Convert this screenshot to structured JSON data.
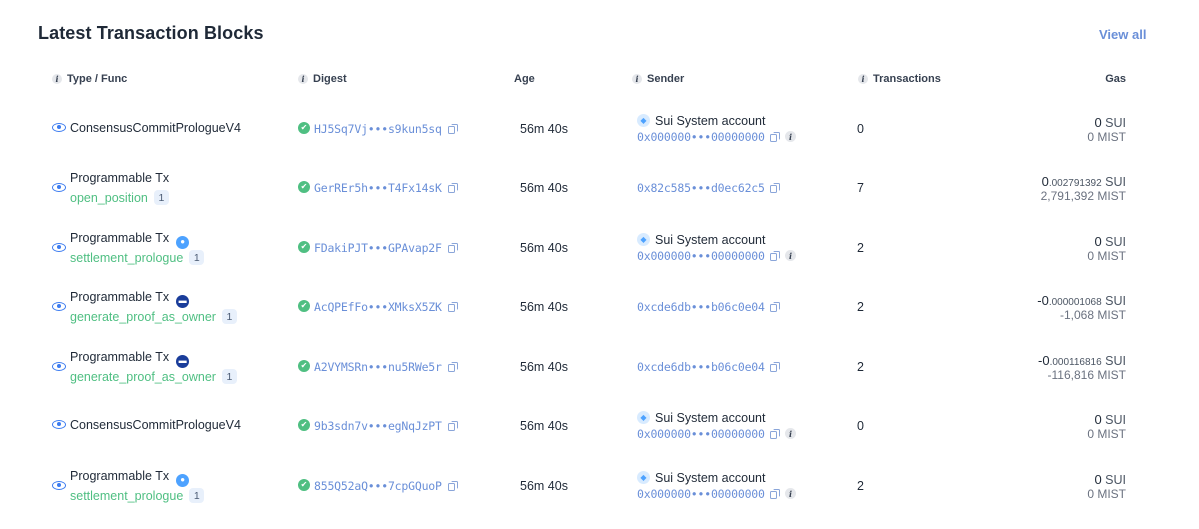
{
  "header": {
    "title": "Latest Transaction Blocks",
    "view_all": "View all"
  },
  "columns": {
    "type": "Type / Func",
    "digest": "Digest",
    "age": "Age",
    "sender": "Sender",
    "transactions": "Transactions",
    "gas": "Gas"
  },
  "rows": [
    {
      "type": "ConsensusCommitPrologueV4",
      "func": "",
      "func_count": "",
      "package_icon": "",
      "digest": "HJ5Sq7Vj•••s9kun5sq",
      "age": "56m 40s",
      "sender_name": "Sui System account",
      "sender_addr": "0x000000•••00000000",
      "tx_count": "0",
      "gas_int": "0",
      "gas_frac": "",
      "gas_unit": "SUI",
      "gas_mist": "0 MIST"
    },
    {
      "type": "Programmable Tx",
      "func": "open_position",
      "func_count": "1",
      "package_icon": "",
      "digest": "GerREr5h•••T4Fx14sK",
      "age": "56m 40s",
      "sender_name": "",
      "sender_addr": "0x82c585•••d0ec62c5",
      "tx_count": "7",
      "gas_int": "0",
      "gas_frac": ".002791392",
      "gas_unit": "SUI",
      "gas_mist": "2,791,392 MIST"
    },
    {
      "type": "Programmable Tx",
      "func": "settlement_prologue",
      "func_count": "1",
      "package_icon": "sui-drop-icon",
      "digest": "FDakiPJT•••GPAvap2F",
      "age": "56m 40s",
      "sender_name": "Sui System account",
      "sender_addr": "0x000000•••00000000",
      "tx_count": "2",
      "gas_int": "0",
      "gas_frac": "",
      "gas_unit": "SUI",
      "gas_mist": "0 MIST"
    },
    {
      "type": "Programmable Tx",
      "func": "generate_proof_as_owner",
      "func_count": "1",
      "package_icon": "dark-package-icon",
      "digest": "AcQPEfFo•••XMksX5ZK",
      "age": "56m 40s",
      "sender_name": "",
      "sender_addr": "0xcde6db•••b06c0e04",
      "tx_count": "2",
      "gas_int": "-0",
      "gas_frac": ".000001068",
      "gas_unit": "SUI",
      "gas_mist": "-1,068 MIST"
    },
    {
      "type": "Programmable Tx",
      "func": "generate_proof_as_owner",
      "func_count": "1",
      "package_icon": "dark-package-icon",
      "digest": "A2VYMSRn•••nu5RWe5r",
      "age": "56m 40s",
      "sender_name": "",
      "sender_addr": "0xcde6db•••b06c0e04",
      "tx_count": "2",
      "gas_int": "-0",
      "gas_frac": ".000116816",
      "gas_unit": "SUI",
      "gas_mist": "-116,816 MIST"
    },
    {
      "type": "ConsensusCommitPrologueV4",
      "func": "",
      "func_count": "",
      "package_icon": "",
      "digest": "9b3sdn7v•••egNqJzPT",
      "age": "56m 40s",
      "sender_name": "Sui System account",
      "sender_addr": "0x000000•••00000000",
      "tx_count": "0",
      "gas_int": "0",
      "gas_frac": "",
      "gas_unit": "SUI",
      "gas_mist": "0 MIST"
    },
    {
      "type": "Programmable Tx",
      "func": "settlement_prologue",
      "func_count": "1",
      "package_icon": "sui-drop-icon",
      "digest": "855Q52aQ•••7cpGQuoP",
      "age": "56m 40s",
      "sender_name": "Sui System account",
      "sender_addr": "0x000000•••00000000",
      "tx_count": "2",
      "gas_int": "0",
      "gas_frac": "",
      "gas_unit": "SUI",
      "gas_mist": "0 MIST"
    }
  ]
}
